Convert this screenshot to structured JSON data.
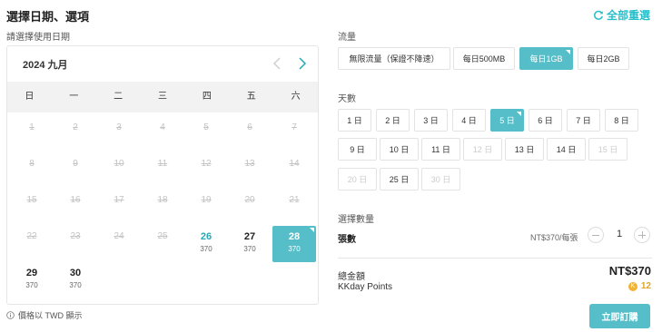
{
  "header": {
    "title": "選擇日期、選項",
    "reset_label": "全部重選"
  },
  "calendar": {
    "label": "請選擇使用日期",
    "month": "2024 九月",
    "weekdays": [
      "日",
      "一",
      "二",
      "三",
      "四",
      "五",
      "六"
    ],
    "past_days": [
      "1",
      "2",
      "3",
      "4",
      "5",
      "6",
      "7",
      "8",
      "9",
      "10",
      "11",
      "12",
      "13",
      "14",
      "15",
      "16",
      "17",
      "18",
      "19",
      "20",
      "21",
      "22",
      "23",
      "24",
      "25"
    ],
    "available_days": [
      {
        "day": "26",
        "price": "370"
      },
      {
        "day": "27",
        "price": "370"
      },
      {
        "day": "28",
        "price": "370"
      },
      {
        "day": "29",
        "price": "370"
      },
      {
        "day": "30",
        "price": "370"
      }
    ],
    "selected_day": "28",
    "price_note": "價格以 TWD 顯示"
  },
  "traffic": {
    "label": "流量",
    "options": [
      "無限流量（保證不降速）",
      "每日500MB",
      "每日1GB",
      "每日2GB"
    ],
    "selected": "每日1GB"
  },
  "days": {
    "label": "天數",
    "options": [
      "1 日",
      "2 日",
      "3 日",
      "4 日",
      "5 日",
      "6 日",
      "7 日",
      "8 日",
      "9 日",
      "10 日",
      "11 日",
      "12 日",
      "13 日",
      "14 日",
      "15 日",
      "20 日",
      "25 日",
      "30 日"
    ],
    "disabled": [
      "12 日",
      "15 日",
      "20 日",
      "30 日"
    ],
    "selected": "5 日"
  },
  "quantity": {
    "label": "選擇數量",
    "item_name": "張數",
    "unit_price": "NT$370/每張",
    "value": "1"
  },
  "total": {
    "label": "總金額",
    "value": "NT$370",
    "points_label": "KKday Points",
    "points_value": "12",
    "points_badge": "K"
  },
  "buy_button": "立即訂購",
  "colors": {
    "accent": "#55bec8",
    "accent_text": "#26bec9",
    "points": "#f2b233"
  }
}
